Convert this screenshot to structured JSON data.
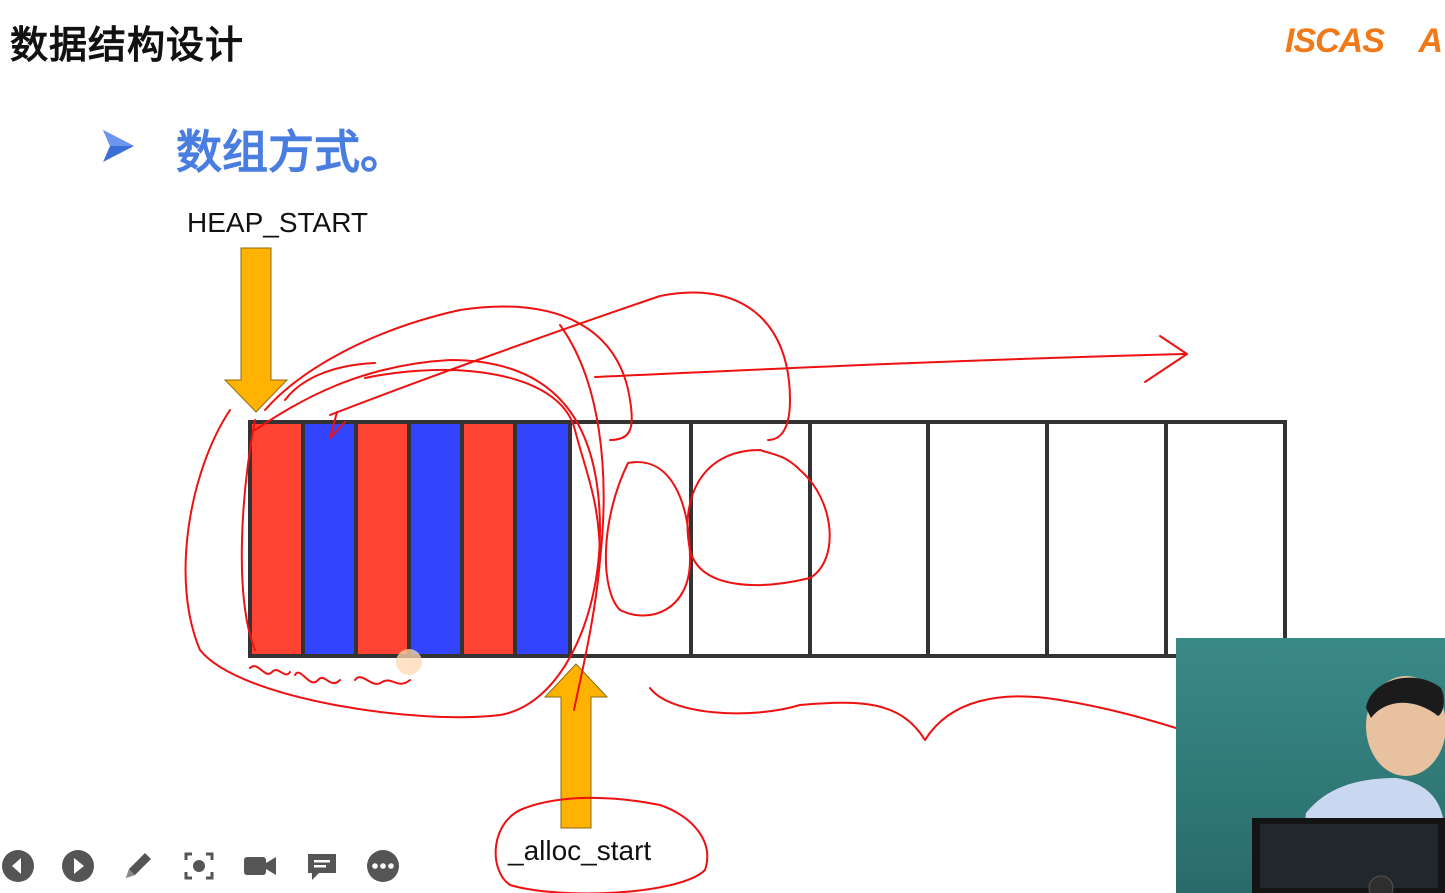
{
  "header": {
    "title": "数据结构设计"
  },
  "logo": {
    "text": "ISCAS",
    "extra": "A"
  },
  "slide": {
    "subtitle": "数组方式。",
    "label_heap_start": "HEAP_START",
    "label_alloc_start": "_alloc_start"
  },
  "diagram": {
    "cells": [
      {
        "fill": "#ff4433"
      },
      {
        "fill": "#3344ff"
      },
      {
        "fill": "#ff4433"
      },
      {
        "fill": "#3344ff"
      },
      {
        "fill": "#ff4433"
      },
      {
        "fill": "#3344ff"
      },
      {
        "fill": "#ffffff"
      },
      {
        "fill": "#ffffff"
      },
      {
        "fill": "#ffffff"
      },
      {
        "fill": "#ffffff"
      },
      {
        "fill": "#ffffff"
      },
      {
        "fill": "#ffffff"
      }
    ],
    "colors": {
      "arrow": "#ffb300",
      "annotation": "#ee1111",
      "bullet": "#3a6fd8"
    }
  },
  "toolbar": {
    "items": [
      {
        "icon": "previous-icon"
      },
      {
        "icon": "next-icon"
      },
      {
        "icon": "pen-icon"
      },
      {
        "icon": "screenshot-icon"
      },
      {
        "icon": "camera-icon"
      },
      {
        "icon": "comment-icon"
      },
      {
        "icon": "more-icon"
      }
    ]
  }
}
